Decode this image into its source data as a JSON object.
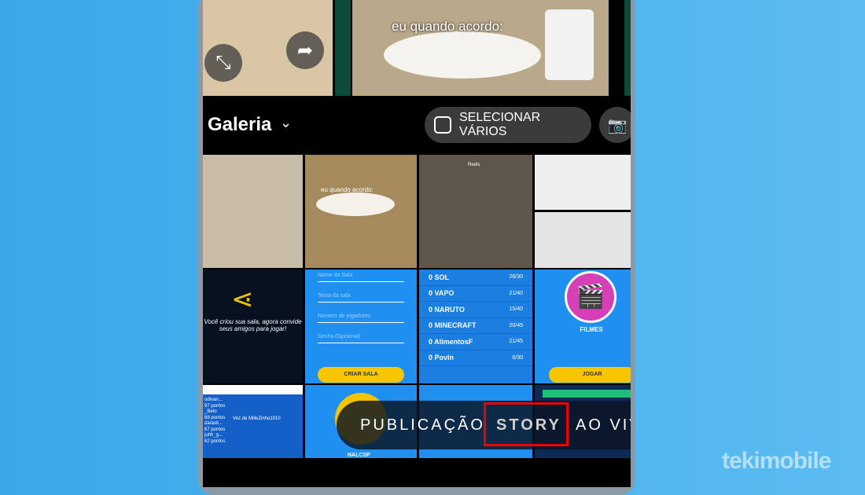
{
  "top_media": {
    "meme_text": "eu quando acordo:",
    "expand_icon": "expand-icon",
    "share_icon": "share-icon"
  },
  "header": {
    "gallery_label": "Galeria",
    "select_multiple_label": "SELECIONAR VÁRIOS"
  },
  "grid": {
    "reels_title": "Reels",
    "share_cell_text": "Você criou sua sala, agora convide seus amigos para jogar!",
    "form_fields": [
      "Nome da Sala",
      "Tema da sala",
      "Número de jogadores",
      "Senha (Opcional)"
    ],
    "create_button": "CRIAR SALA",
    "rooms": [
      {
        "name": "0 SOL",
        "count": "26/30"
      },
      {
        "name": "0 VAPO",
        "count": "21/40"
      },
      {
        "name": "0 NARUTO",
        "count": "15/40"
      },
      {
        "name": "0 MINECRAFT",
        "count": "20/45"
      },
      {
        "name": "0 AlimentosF",
        "count": "21/45"
      },
      {
        "name": "0 Povin",
        "count": "6/30"
      }
    ],
    "category_label": "FILMES",
    "play_button": "JOGAR",
    "players": [
      {
        "name": "odivan...",
        "points": "97 pontos"
      },
      {
        "name": "_Beto",
        "points": "68 pontos"
      },
      {
        "name": "darasil...",
        "points": "67 pontos"
      },
      {
        "name": "juhh_g...",
        "points": "62 pontos"
      }
    ],
    "turn_text": "Vez de MilleZinho1010",
    "bottom_label": "NALCSP"
  },
  "modes": {
    "items": [
      "PUBLICAÇÃO",
      "STORY",
      "AO VIVO"
    ],
    "selected": "STORY",
    "highlight_color": "#e00000"
  },
  "watermark": "tekimobile"
}
